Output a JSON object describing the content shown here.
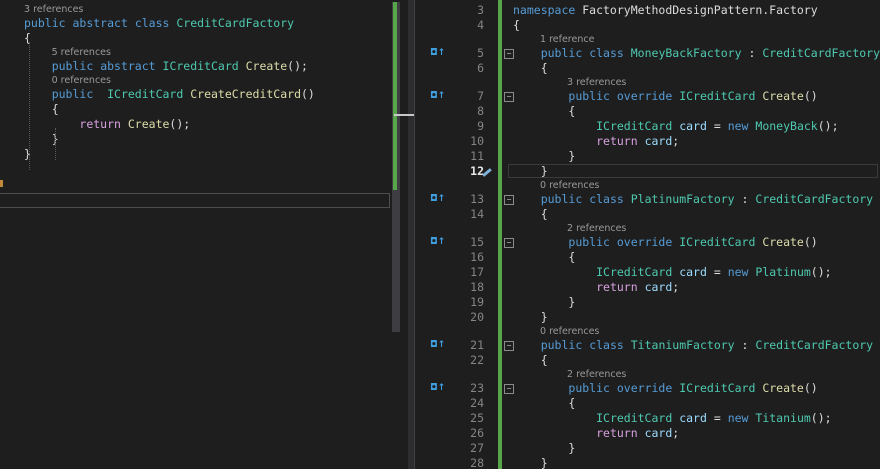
{
  "left_editor": {
    "lines": [
      {
        "lens": "3 references"
      },
      {
        "tokens": [
          [
            "k",
            "public"
          ],
          [
            "t",
            " "
          ],
          [
            "k",
            "abstract"
          ],
          [
            "t",
            " "
          ],
          [
            "k",
            "class"
          ],
          [
            "t",
            " "
          ],
          [
            "c",
            "CreditCardFactory"
          ]
        ]
      },
      {
        "tokens": [
          [
            "t",
            "{"
          ]
        ]
      },
      {
        "lens": "5 references"
      },
      {
        "tokens": [
          [
            "t",
            "    "
          ],
          [
            "k",
            "public"
          ],
          [
            "t",
            " "
          ],
          [
            "k",
            "abstract"
          ],
          [
            "t",
            " "
          ],
          [
            "c",
            "ICreditCard"
          ],
          [
            "t",
            " "
          ],
          [
            "m",
            "Create"
          ],
          [
            "t",
            "();"
          ]
        ]
      },
      {
        "lens": "0 references"
      },
      {
        "tokens": [
          [
            "t",
            "    "
          ],
          [
            "k",
            "public"
          ],
          [
            "t",
            "  "
          ],
          [
            "c",
            "ICreditCard"
          ],
          [
            "t",
            " "
          ],
          [
            "m",
            "CreateCreditCard"
          ],
          [
            "t",
            "()"
          ]
        ]
      },
      {
        "tokens": [
          [
            "t",
            "    {"
          ]
        ]
      },
      {
        "tokens": [
          [
            "t",
            "        "
          ],
          [
            "p",
            "return"
          ],
          [
            "t",
            " "
          ],
          [
            "m",
            "Create"
          ],
          [
            "t",
            "();"
          ]
        ]
      },
      {
        "tokens": [
          [
            "t",
            "    }"
          ]
        ]
      },
      {
        "tokens": [
          [
            "t",
            "}"
          ]
        ]
      }
    ]
  },
  "right_editor": {
    "rows": [
      {
        "n": "3",
        "tokens": [
          [
            "k",
            "namespace"
          ],
          [
            "t",
            " FactoryMethodDesignPattern.Factory"
          ]
        ]
      },
      {
        "n": "4",
        "tokens": [
          [
            "t",
            "{"
          ]
        ]
      },
      {
        "lens": "1 reference"
      },
      {
        "n": "5",
        "glyph": "◘↑",
        "tokens": [
          [
            "t",
            "    "
          ],
          [
            "k",
            "public"
          ],
          [
            "t",
            " "
          ],
          [
            "k",
            "class"
          ],
          [
            "t",
            " "
          ],
          [
            "c",
            "MoneyBackFactory"
          ],
          [
            "t",
            " : "
          ],
          [
            "c",
            "CreditCardFactory"
          ]
        ]
      },
      {
        "n": "6",
        "tokens": [
          [
            "t",
            "    {"
          ]
        ]
      },
      {
        "lens": "3 references",
        "indent": 8
      },
      {
        "n": "7",
        "glyph": "◘↑",
        "tokens": [
          [
            "t",
            "        "
          ],
          [
            "k",
            "public"
          ],
          [
            "t",
            " "
          ],
          [
            "k",
            "override"
          ],
          [
            "t",
            " "
          ],
          [
            "c",
            "ICreditCard"
          ],
          [
            "t",
            " "
          ],
          [
            "m",
            "Create"
          ],
          [
            "t",
            "()"
          ]
        ]
      },
      {
        "n": "8",
        "tokens": [
          [
            "t",
            "        {"
          ]
        ]
      },
      {
        "n": "9",
        "tokens": [
          [
            "t",
            "            "
          ],
          [
            "c",
            "ICreditCard"
          ],
          [
            "t",
            " "
          ],
          [
            "v",
            "card"
          ],
          [
            "t",
            " = "
          ],
          [
            "k",
            "new"
          ],
          [
            "t",
            " "
          ],
          [
            "c",
            "MoneyBack"
          ],
          [
            "t",
            "();"
          ]
        ]
      },
      {
        "n": "10",
        "tokens": [
          [
            "t",
            "            "
          ],
          [
            "p",
            "return"
          ],
          [
            "t",
            " "
          ],
          [
            "v",
            "card"
          ],
          [
            "t",
            ";"
          ]
        ]
      },
      {
        "n": "11",
        "tokens": [
          [
            "t",
            "        }"
          ]
        ]
      },
      {
        "n": "12",
        "current": true,
        "tokens": [
          [
            "t",
            "    }"
          ]
        ]
      },
      {
        "lens": "0 references"
      },
      {
        "n": "13",
        "glyph": "◘↑",
        "tokens": [
          [
            "t",
            "    "
          ],
          [
            "k",
            "public"
          ],
          [
            "t",
            " "
          ],
          [
            "k",
            "class"
          ],
          [
            "t",
            " "
          ],
          [
            "c",
            "PlatinumFactory"
          ],
          [
            "t",
            " : "
          ],
          [
            "c",
            "CreditCardFactory"
          ]
        ]
      },
      {
        "n": "14",
        "tokens": [
          [
            "t",
            "    {"
          ]
        ]
      },
      {
        "lens": "2 references",
        "indent": 8
      },
      {
        "n": "15",
        "glyph": "◘↑",
        "tokens": [
          [
            "t",
            "        "
          ],
          [
            "k",
            "public"
          ],
          [
            "t",
            " "
          ],
          [
            "k",
            "override"
          ],
          [
            "t",
            " "
          ],
          [
            "c",
            "ICreditCard"
          ],
          [
            "t",
            " "
          ],
          [
            "m",
            "Create"
          ],
          [
            "t",
            "()"
          ]
        ]
      },
      {
        "n": "16",
        "tokens": [
          [
            "t",
            "        {"
          ]
        ]
      },
      {
        "n": "17",
        "tokens": [
          [
            "t",
            "            "
          ],
          [
            "c",
            "ICreditCard"
          ],
          [
            "t",
            " "
          ],
          [
            "v",
            "card"
          ],
          [
            "t",
            " = "
          ],
          [
            "k",
            "new"
          ],
          [
            "t",
            " "
          ],
          [
            "c",
            "Platinum"
          ],
          [
            "t",
            "();"
          ]
        ]
      },
      {
        "n": "18",
        "tokens": [
          [
            "t",
            "            "
          ],
          [
            "p",
            "return"
          ],
          [
            "t",
            " "
          ],
          [
            "v",
            "card"
          ],
          [
            "t",
            ";"
          ]
        ]
      },
      {
        "n": "19",
        "tokens": [
          [
            "t",
            "        }"
          ]
        ]
      },
      {
        "n": "20",
        "tokens": [
          [
            "t",
            "    }"
          ]
        ]
      },
      {
        "lens": "0 references"
      },
      {
        "n": "21",
        "glyph": "◘↑",
        "tokens": [
          [
            "t",
            "    "
          ],
          [
            "k",
            "public"
          ],
          [
            "t",
            " "
          ],
          [
            "k",
            "class"
          ],
          [
            "t",
            " "
          ],
          [
            "c",
            "TitaniumFactory"
          ],
          [
            "t",
            " : "
          ],
          [
            "c",
            "CreditCardFactory"
          ]
        ]
      },
      {
        "n": "22",
        "tokens": [
          [
            "t",
            "    {"
          ]
        ]
      },
      {
        "lens": "2 references",
        "indent": 8
      },
      {
        "n": "23",
        "glyph": "◘↑",
        "tokens": [
          [
            "t",
            "        "
          ],
          [
            "k",
            "public"
          ],
          [
            "t",
            " "
          ],
          [
            "k",
            "override"
          ],
          [
            "t",
            " "
          ],
          [
            "c",
            "ICreditCard"
          ],
          [
            "t",
            " "
          ],
          [
            "m",
            "Create"
          ],
          [
            "t",
            "()"
          ]
        ]
      },
      {
        "n": "24",
        "tokens": [
          [
            "t",
            "        {"
          ]
        ]
      },
      {
        "n": "25",
        "tokens": [
          [
            "t",
            "            "
          ],
          [
            "c",
            "ICreditCard"
          ],
          [
            "t",
            " "
          ],
          [
            "v",
            "card"
          ],
          [
            "t",
            " = "
          ],
          [
            "k",
            "new"
          ],
          [
            "t",
            " "
          ],
          [
            "c",
            "Titanium"
          ],
          [
            "t",
            "();"
          ]
        ]
      },
      {
        "n": "26",
        "tokens": [
          [
            "t",
            "            "
          ],
          [
            "p",
            "return"
          ],
          [
            "t",
            " "
          ],
          [
            "v",
            "card"
          ],
          [
            "t",
            ";"
          ]
        ]
      },
      {
        "n": "27",
        "tokens": [
          [
            "t",
            "        }"
          ]
        ]
      },
      {
        "n": "28",
        "tokens": [
          [
            "t",
            "    }"
          ]
        ]
      }
    ]
  },
  "colors": {
    "keyword": "#569cd6",
    "type": "#4ec9b0",
    "method": "#dcdcaa",
    "variable": "#9cdcfe",
    "control": "#d8a0df",
    "text": "#dcdcdc",
    "codelens": "#999999",
    "change_bar": "#57a64a",
    "background": "#1e1e1e"
  }
}
